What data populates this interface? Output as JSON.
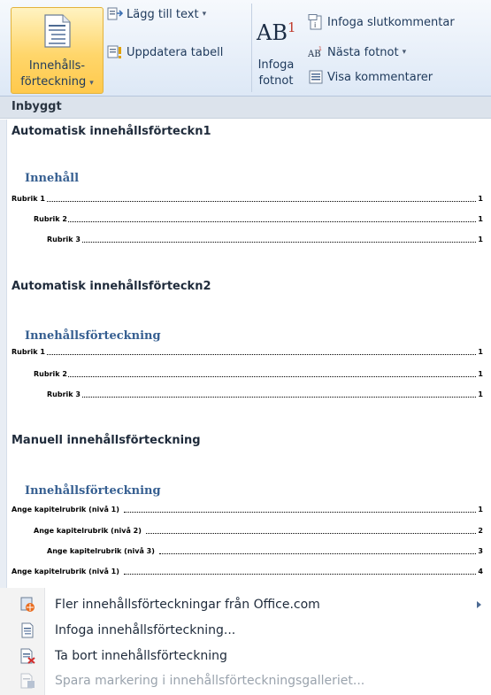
{
  "ribbon": {
    "toc_button": {
      "line1": "Innehålls-",
      "line2": "förteckning",
      "icon": "toc-document-icon"
    },
    "add_text": {
      "label": "Lägg till text",
      "icon": "add-text-icon"
    },
    "update_table": {
      "label": "Uppdatera tabell",
      "icon": "update-table-icon"
    },
    "footnote_glyph": {
      "base": "AB",
      "sup": "1"
    },
    "insert_footnote": {
      "line1": "Infoga",
      "line2": "fotnot"
    },
    "insert_endnote": {
      "label": "Infoga slutkommentar",
      "icon": "endnote-icon"
    },
    "next_footnote": {
      "label": "Nästa fotnot",
      "icon": "next-footnote-icon"
    },
    "show_notes": {
      "label": "Visa kommentarer",
      "icon": "show-notes-icon"
    }
  },
  "gallery": {
    "category": "Inbyggt",
    "sections": [
      {
        "title": "Automatisk innehållsförteckn1",
        "heading": "Innehåll",
        "entries": [
          {
            "text": "Rubrik 1",
            "page": "1",
            "level": 1
          },
          {
            "text": "Rubrik 2",
            "page": "1",
            "level": 2
          },
          {
            "text": "Rubrik 3",
            "page": "1",
            "level": 3
          }
        ]
      },
      {
        "title": "Automatisk innehållsförteckn2",
        "heading": "Innehållsförteckning",
        "entries": [
          {
            "text": "Rubrik 1",
            "page": "1",
            "level": 1
          },
          {
            "text": "Rubrik 2",
            "page": "1",
            "level": 2
          },
          {
            "text": "Rubrik 3",
            "page": "1",
            "level": 3
          }
        ]
      },
      {
        "title": "Manuell innehållsförteckning",
        "heading": "Innehållsförteckning",
        "entries": [
          {
            "text": "Ange kapitelrubrik (nivå 1)",
            "page": "1",
            "level": 1
          },
          {
            "text": "Ange kapitelrubrik (nivå 2)",
            "page": "2",
            "level": 2
          },
          {
            "text": "Ange kapitelrubrik (nivå 3)",
            "page": "3",
            "level": 3
          },
          {
            "text": "Ange kapitelrubrik (nivå 1)",
            "page": "4",
            "level": 1
          }
        ]
      }
    ]
  },
  "commands": [
    {
      "label": "Fler innehållsförteckningar från Office.com",
      "icon": "office-globe-icon",
      "submenu": true,
      "enabled": true
    },
    {
      "label": "Infoga innehållsförteckning...",
      "icon": "insert-toc-icon",
      "submenu": false,
      "enabled": true
    },
    {
      "label": "Ta bort innehållsförteckning",
      "icon": "remove-toc-icon",
      "submenu": false,
      "enabled": true
    },
    {
      "label": "Spara markering i innehållsförteckningsgalleriet...",
      "icon": "save-selection-icon",
      "submenu": false,
      "enabled": false
    }
  ]
}
